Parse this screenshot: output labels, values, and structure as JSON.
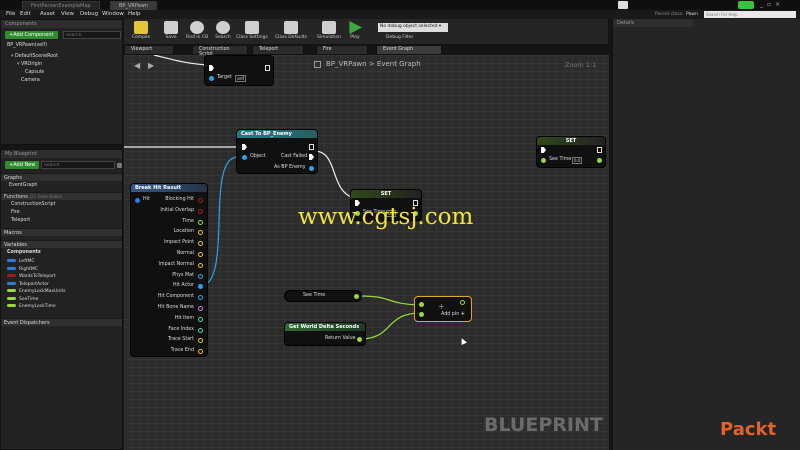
{
  "window": {
    "tabs": [
      "FirstPersonExampleMap",
      "BP_VRPawn"
    ],
    "parent_class_label": "Parent class:",
    "parent_class_value": "Pawn",
    "search_help_placeholder": "Search For Help"
  },
  "menu": [
    "File",
    "Edit",
    "Asset",
    "View",
    "Debug",
    "Window",
    "Help"
  ],
  "toolbar": {
    "buttons": [
      "Compile",
      "Save",
      "Find in CB",
      "Search",
      "Class Settings",
      "Class Defaults",
      "Simulation",
      "Play"
    ],
    "debug_object": "No debug object selected",
    "debug_filter": "Debug Filter"
  },
  "components": {
    "title": "Components",
    "add_button": "+Add Component",
    "search_placeholder": "Search",
    "self_label": "BP_VRPawn(self)",
    "tree": [
      "DefaultSceneRoot",
      "VROrigin",
      "Capsule",
      "Camera"
    ]
  },
  "my_blueprint": {
    "title": "My Blueprint",
    "add_button": "+Add New",
    "search_placeholder": "Search",
    "graphs_label": "Graphs",
    "event_graph": "EventGraph",
    "functions_label": "Functions",
    "functions_note": "(21 Overridable)",
    "functions": [
      "ConstructionScript",
      "Fire",
      "Teleport"
    ],
    "macros_label": "Macros",
    "variables_label": "Variables",
    "components_label": "Components",
    "variables": [
      {
        "name": "LeftMC",
        "color": "#2a7fd4"
      },
      {
        "name": "RightMC",
        "color": "#2a7fd4"
      },
      {
        "name": "WantsToTeleport",
        "color": "#a11d1d"
      },
      {
        "name": "TeleportActor",
        "color": "#2a7fd4"
      },
      {
        "name": "EnemyLockMaxUnits",
        "color": "#9bd83b"
      },
      {
        "name": "SeeTime",
        "color": "#9bd83b"
      },
      {
        "name": "EnemyLockTime",
        "color": "#9bd83b"
      }
    ],
    "event_dispatchers_label": "Event Dispatchers"
  },
  "graph_tabs": [
    "Viewport",
    "Construction Script",
    "Teleport",
    "Fire",
    "Event Graph"
  ],
  "graph": {
    "breadcrumb_root": "BP_VRPawn",
    "breadcrumb_sep": ">",
    "breadcrumb_leaf": "Event Graph",
    "zoom": "Zoom 1:1",
    "watermark": "BLUEPRINT",
    "url_overlay": "www.cgtsj.com",
    "brand": "Packt"
  },
  "nodes": {
    "top": {
      "target_label": "Target",
      "target_value": "self"
    },
    "cast": {
      "title": "Cast To BP_Enemy",
      "object": "Object",
      "cast_failed": "Cast Failed",
      "as_enemy": "As BP Enemy"
    },
    "set1": {
      "title": "SET",
      "see_time": "See Time",
      "value": "0.0"
    },
    "set2": {
      "title": "SET",
      "see_time": "See Time",
      "value": "0.0"
    },
    "break_hit": {
      "title": "Break Hit Result",
      "pins": [
        "Blocking Hit",
        "Initial Overlap",
        "Time",
        "Location",
        "Impact Point",
        "Normal",
        "Impact Normal",
        "Phys Mat",
        "Hit Actor",
        "Hit Component",
        "Hit Bone Name",
        "Hit Item",
        "Face Index",
        "Trace Start",
        "Trace End"
      ],
      "hit_label": "Hit"
    },
    "seetime_getter": {
      "label": "See Time"
    },
    "delta": {
      "title": "Get World Delta Seconds",
      "return": "Return Value"
    },
    "add": {
      "add_pin": "Add pin"
    }
  },
  "details": {
    "title": "Details"
  }
}
